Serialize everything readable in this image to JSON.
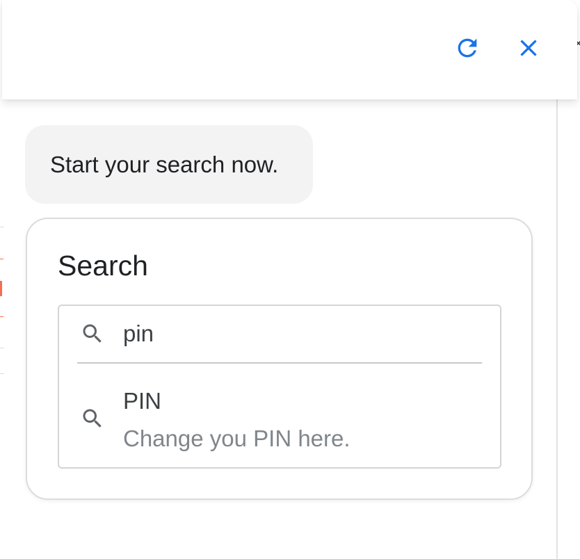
{
  "header": {
    "refresh_icon": "refresh-icon",
    "close_icon": "close-icon",
    "accent_color": "#1a73e8"
  },
  "chat": {
    "message": "Start your search now."
  },
  "search_card": {
    "title": "Search",
    "input_value": "pin",
    "search_icon": "search-icon",
    "results": [
      {
        "title": "PIN",
        "description": "Change you PIN here.",
        "icon": "search-icon"
      }
    ]
  },
  "colors": {
    "text_primary": "#202124",
    "text_secondary": "#80868b",
    "bubble_bg": "#f3f3f3",
    "border": "#dcdcdc"
  }
}
